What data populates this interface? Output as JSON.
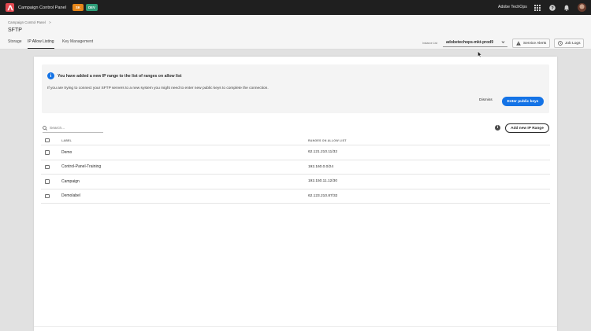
{
  "topbar": {
    "app_title": "Campaign Control Panel",
    "tags": [
      "SK",
      "DEV"
    ],
    "org_name": "Adobe TechOps",
    "icons": [
      "apps-grid-icon",
      "help-icon",
      "bell-icon"
    ]
  },
  "header": {
    "breadcrumb": "Campaign Control Panel",
    "breadcrumb_sep": ">",
    "page_title": "SFTP",
    "tabs": [
      {
        "label": "Storage"
      },
      {
        "label": "IP Allow Listing",
        "active": true
      },
      {
        "label": "Key Management"
      }
    ],
    "instance_label": "Instance List",
    "instance_value": "adobetechops-mkt-prod9",
    "service_alerts": "Service Alerts",
    "job_logs": "Job Logs"
  },
  "banner": {
    "title": "You have added a new IP range to the list of ranges on allow list",
    "text": "If you are trying to connect your SFTP servers to a new system you might need to enter new public keys to complete the connection.",
    "dismiss": "Dismiss",
    "primary": "Enter public keys",
    "accent": "#1473e6"
  },
  "toolbar": {
    "search_placeholder": "Search...",
    "add_button": "Add new IP Range"
  },
  "table": {
    "columns": [
      "LABEL",
      "RANGES ON ALLOW LIST"
    ],
    "rows": [
      {
        "label": "Demo",
        "range": "62.121.210.11/32"
      },
      {
        "label": "Control-Panel-Training",
        "range": "192.160.0.0/24"
      },
      {
        "label": "Campaign",
        "range": "192.150.11.12/30"
      },
      {
        "label": "Demolabel",
        "range": "62.123.210.87/32"
      }
    ]
  }
}
